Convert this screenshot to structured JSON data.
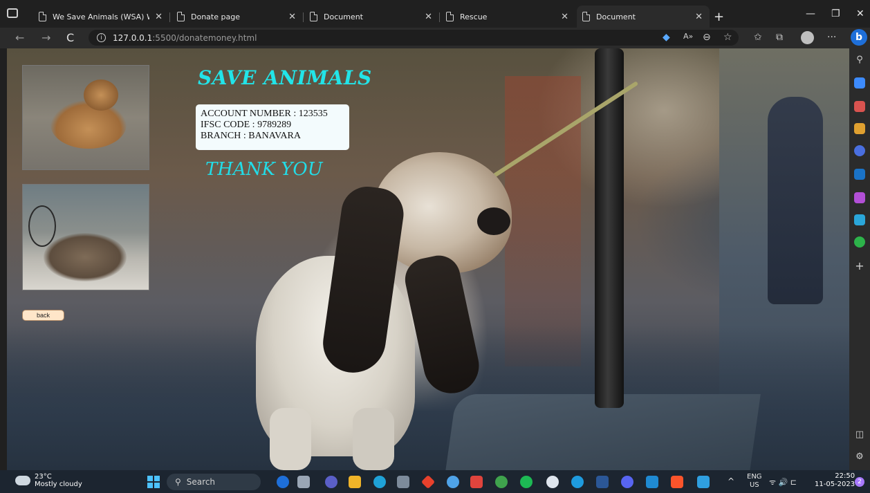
{
  "browser": {
    "tabs": [
      {
        "title": "We Save Animals (WSA) Welfare",
        "close": "✕"
      },
      {
        "title": "Donate page",
        "close": "✕"
      },
      {
        "title": "Document",
        "close": "✕"
      },
      {
        "title": "Rescue",
        "close": "✕"
      },
      {
        "title": "Document",
        "close": "✕"
      }
    ],
    "new_tab": "+",
    "window_controls": {
      "minimize": "—",
      "maximize": "❐",
      "close": "✕"
    },
    "url_host": "127.0.0.1",
    "url_path": ":5500/donatemoney.html",
    "nav": {
      "back": "←",
      "forward": "→",
      "reload": "C",
      "info": "i"
    },
    "toolbar_icons": [
      "A»",
      "⊖",
      "☆",
      "✩",
      "⧉",
      "···"
    ],
    "copilot": "b"
  },
  "page": {
    "title": "SAVE ANIMALS",
    "account": {
      "line1": "ACCOUNT NUMBER : 123535",
      "line2": "IFSC CODE : 9789289",
      "line3": "BRANCH : BANAVARA"
    },
    "thank_you": "THANK YOU",
    "back_label": "back"
  },
  "sidebar": {
    "icons": [
      "search-icon",
      "tag-icon",
      "toolbox-icon",
      "people-icon",
      "copilot-icon",
      "outlook-icon",
      "designer-icon",
      "send-icon",
      "tree-icon",
      "add-icon"
    ],
    "add": "+",
    "search": "⚲",
    "panel": "◫",
    "settings": "⚙"
  },
  "taskbar": {
    "temperature": "23°C",
    "weather": "Mostly cloudy",
    "search_placeholder": "Search",
    "search_glyph": "⚲",
    "lang_top": "ENG",
    "lang_bottom": "US",
    "tray_up": "^",
    "tray_icons": "ᯤ  🔊  ⊏",
    "time": "22:50",
    "date": "11-05-2023",
    "notifications": "2"
  },
  "colors": {
    "title": "#22e4e8",
    "thankyou": "#22dde8",
    "back_button": "#ffe6c9",
    "account_box": "#f3fbfd",
    "browser_accent": "#1e6fd9"
  }
}
